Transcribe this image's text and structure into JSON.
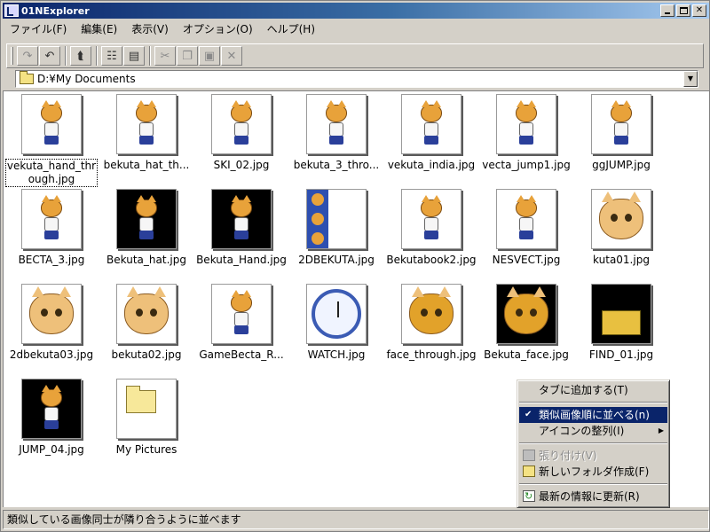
{
  "window": {
    "title": "01NExplorer"
  },
  "menu": [
    {
      "label": "ファイル(F)"
    },
    {
      "label": "編集(E)"
    },
    {
      "label": "表示(V)"
    },
    {
      "label": "オプション(O)"
    },
    {
      "label": "ヘルプ(H)"
    }
  ],
  "toolbar": {
    "buttons": [
      {
        "name": "redo",
        "icon": "redo-icon",
        "glyph": "↷",
        "enabled": false
      },
      {
        "name": "undo",
        "icon": "undo-icon",
        "glyph": "↶",
        "enabled": true
      },
      {
        "name": "up-folder",
        "icon": "up-folder-icon",
        "glyph": "⮬",
        "enabled": true
      },
      {
        "name": "tree-view",
        "icon": "tree-view-icon",
        "glyph": "☷",
        "enabled": true
      },
      {
        "name": "details-view",
        "icon": "details-view-icon",
        "glyph": "▤",
        "enabled": true
      },
      {
        "name": "cut",
        "icon": "cut-icon",
        "glyph": "✂",
        "enabled": false
      },
      {
        "name": "copy",
        "icon": "copy-icon",
        "glyph": "❐",
        "enabled": false
      },
      {
        "name": "paste",
        "icon": "paste-icon",
        "glyph": "▣",
        "enabled": false
      },
      {
        "name": "delete",
        "icon": "delete-icon",
        "glyph": "✕",
        "enabled": false
      }
    ]
  },
  "address": {
    "path": "D:¥My Documents"
  },
  "files": [
    {
      "name": "vekuta_hand_through.jpg",
      "label_line1": "vekuta_hand_thr",
      "label_line2": "ough.jpg",
      "thumb": "cat"
    },
    {
      "name": "bekuta_hat_th...",
      "thumb": "cat"
    },
    {
      "name": "SKI_02.jpg",
      "thumb": "cat"
    },
    {
      "name": "bekuta_3_thro...",
      "thumb": "cat"
    },
    {
      "name": "vekuta_india.jpg",
      "thumb": "cat"
    },
    {
      "name": "vecta_jump1.jpg",
      "thumb": "cat"
    },
    {
      "name": "ggJUMP.jpg",
      "thumb": "cat"
    },
    {
      "name": "BECTA_3.jpg",
      "thumb": "cat"
    },
    {
      "name": "Bekuta_hat.jpg",
      "thumb": "cat-dark"
    },
    {
      "name": "Bekuta_Hand.jpg",
      "thumb": "cat-dark"
    },
    {
      "name": "2DBEKUTA.jpg",
      "thumb": "strip"
    },
    {
      "name": "Bekutabook2.jpg",
      "thumb": "cat"
    },
    {
      "name": "NESVECT.jpg",
      "thumb": "cat"
    },
    {
      "name": "kuta01.jpg",
      "thumb": "face"
    },
    {
      "name": "2dbekuta03.jpg",
      "thumb": "face"
    },
    {
      "name": "bekuta02.jpg",
      "thumb": "face"
    },
    {
      "name": "GameBecta_R...",
      "thumb": "cat"
    },
    {
      "name": "WATCH.jpg",
      "thumb": "clock"
    },
    {
      "name": "face_through.jpg",
      "thumb": "face-big"
    },
    {
      "name": "Bekuta_face.jpg",
      "thumb": "face-big-dark"
    },
    {
      "name": "FIND_01.jpg",
      "thumb": "box-dark"
    },
    {
      "name": "JUMP_04.jpg",
      "thumb": "cat-dark"
    },
    {
      "name": "My Pictures",
      "thumb": "folder"
    }
  ],
  "context_menu": {
    "items": [
      {
        "label": "タブに追加する(T)",
        "type": "item"
      },
      {
        "type": "separator"
      },
      {
        "label": "類似画像順に並べる(n)",
        "type": "item",
        "checked": true,
        "selected": true
      },
      {
        "label": "アイコンの整列(I)",
        "type": "submenu"
      },
      {
        "type": "separator"
      },
      {
        "label": "張り付け(V)",
        "type": "item",
        "disabled": true,
        "icon": "paste-icon"
      },
      {
        "label": "新しいフォルダ作成(F)",
        "type": "item",
        "icon": "new-folder-icon"
      },
      {
        "type": "separator"
      },
      {
        "label": "最新の情報に更新(R)",
        "type": "item",
        "icon": "refresh-icon"
      }
    ],
    "check_glyph": "✔",
    "arrow_glyph": "▶"
  },
  "status": {
    "text": "類似している画像同士が隣り合うように並べます"
  },
  "colors": {
    "title_gradient_start": "#0a246a",
    "title_gradient_end": "#a6caf0",
    "selection": "#0a246a",
    "face": "#d4d0c8"
  }
}
